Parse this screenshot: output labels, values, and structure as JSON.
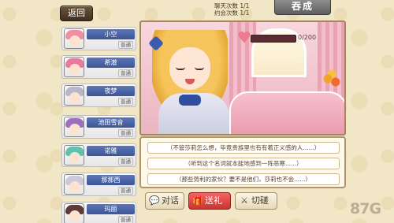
{
  "header": {
    "back_label": "返回",
    "chat_count": "聊天次数 1/1",
    "date_count": "约会次数 1/1",
    "title": "吞成"
  },
  "characters": [
    {
      "name": "小空",
      "tag": "普通",
      "hair": "#f08fa4"
    },
    {
      "name": "希澈",
      "tag": "普通",
      "hair": "#e97a9b"
    },
    {
      "name": "夜梦",
      "tag": "普通",
      "hair": "#b7b7c9"
    },
    {
      "name": "池田雪音",
      "tag": "普通",
      "hair": "#9d6fc0"
    },
    {
      "name": "诺雅",
      "tag": "普通",
      "hair": "#5fc1b2"
    },
    {
      "name": "那那西",
      "tag": "普通",
      "hair": "#c9c9d9"
    },
    {
      "name": "玛丽",
      "tag": "普通",
      "hair": "#5c3a3a"
    }
  ],
  "affection": {
    "value_text": "0/200",
    "current": 0,
    "max": 200
  },
  "dialogue_options": [
    "（不管莎莉怎么想，毕竟贵族里也有有着正义感的人......）",
    "（听到这个名词就本能地感到一阵恶寒......）",
    "（那些势利的家伙？要不是他们，莎莉也不会......）"
  ],
  "actions": {
    "talk": {
      "label": "对话",
      "icon": "speech-bubble-icon"
    },
    "gift": {
      "label": "送礼",
      "icon": "gift-icon"
    },
    "spar": {
      "label": "切磋",
      "icon": "sword-icon"
    }
  },
  "watermark": "87G",
  "colors": {
    "accent": "#3c5596",
    "gift": "#d8403a",
    "heart": "#f07a8d"
  }
}
